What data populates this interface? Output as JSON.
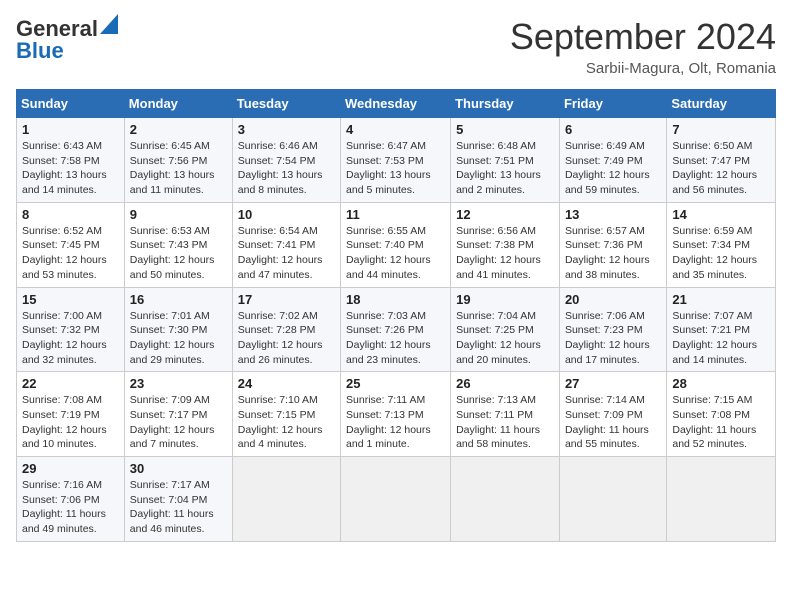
{
  "header": {
    "logo_line1": "General",
    "logo_line2": "Blue",
    "month_title": "September 2024",
    "location": "Sarbii-Magura, Olt, Romania"
  },
  "columns": [
    "Sunday",
    "Monday",
    "Tuesday",
    "Wednesday",
    "Thursday",
    "Friday",
    "Saturday"
  ],
  "weeks": [
    [
      {
        "day": "1",
        "info": "Sunrise: 6:43 AM\nSunset: 7:58 PM\nDaylight: 13 hours\nand 14 minutes."
      },
      {
        "day": "2",
        "info": "Sunrise: 6:45 AM\nSunset: 7:56 PM\nDaylight: 13 hours\nand 11 minutes."
      },
      {
        "day": "3",
        "info": "Sunrise: 6:46 AM\nSunset: 7:54 PM\nDaylight: 13 hours\nand 8 minutes."
      },
      {
        "day": "4",
        "info": "Sunrise: 6:47 AM\nSunset: 7:53 PM\nDaylight: 13 hours\nand 5 minutes."
      },
      {
        "day": "5",
        "info": "Sunrise: 6:48 AM\nSunset: 7:51 PM\nDaylight: 13 hours\nand 2 minutes."
      },
      {
        "day": "6",
        "info": "Sunrise: 6:49 AM\nSunset: 7:49 PM\nDaylight: 12 hours\nand 59 minutes."
      },
      {
        "day": "7",
        "info": "Sunrise: 6:50 AM\nSunset: 7:47 PM\nDaylight: 12 hours\nand 56 minutes."
      }
    ],
    [
      {
        "day": "8",
        "info": "Sunrise: 6:52 AM\nSunset: 7:45 PM\nDaylight: 12 hours\nand 53 minutes."
      },
      {
        "day": "9",
        "info": "Sunrise: 6:53 AM\nSunset: 7:43 PM\nDaylight: 12 hours\nand 50 minutes."
      },
      {
        "day": "10",
        "info": "Sunrise: 6:54 AM\nSunset: 7:41 PM\nDaylight: 12 hours\nand 47 minutes."
      },
      {
        "day": "11",
        "info": "Sunrise: 6:55 AM\nSunset: 7:40 PM\nDaylight: 12 hours\nand 44 minutes."
      },
      {
        "day": "12",
        "info": "Sunrise: 6:56 AM\nSunset: 7:38 PM\nDaylight: 12 hours\nand 41 minutes."
      },
      {
        "day": "13",
        "info": "Sunrise: 6:57 AM\nSunset: 7:36 PM\nDaylight: 12 hours\nand 38 minutes."
      },
      {
        "day": "14",
        "info": "Sunrise: 6:59 AM\nSunset: 7:34 PM\nDaylight: 12 hours\nand 35 minutes."
      }
    ],
    [
      {
        "day": "15",
        "info": "Sunrise: 7:00 AM\nSunset: 7:32 PM\nDaylight: 12 hours\nand 32 minutes."
      },
      {
        "day": "16",
        "info": "Sunrise: 7:01 AM\nSunset: 7:30 PM\nDaylight: 12 hours\nand 29 minutes."
      },
      {
        "day": "17",
        "info": "Sunrise: 7:02 AM\nSunset: 7:28 PM\nDaylight: 12 hours\nand 26 minutes."
      },
      {
        "day": "18",
        "info": "Sunrise: 7:03 AM\nSunset: 7:26 PM\nDaylight: 12 hours\nand 23 minutes."
      },
      {
        "day": "19",
        "info": "Sunrise: 7:04 AM\nSunset: 7:25 PM\nDaylight: 12 hours\nand 20 minutes."
      },
      {
        "day": "20",
        "info": "Sunrise: 7:06 AM\nSunset: 7:23 PM\nDaylight: 12 hours\nand 17 minutes."
      },
      {
        "day": "21",
        "info": "Sunrise: 7:07 AM\nSunset: 7:21 PM\nDaylight: 12 hours\nand 14 minutes."
      }
    ],
    [
      {
        "day": "22",
        "info": "Sunrise: 7:08 AM\nSunset: 7:19 PM\nDaylight: 12 hours\nand 10 minutes."
      },
      {
        "day": "23",
        "info": "Sunrise: 7:09 AM\nSunset: 7:17 PM\nDaylight: 12 hours\nand 7 minutes."
      },
      {
        "day": "24",
        "info": "Sunrise: 7:10 AM\nSunset: 7:15 PM\nDaylight: 12 hours\nand 4 minutes."
      },
      {
        "day": "25",
        "info": "Sunrise: 7:11 AM\nSunset: 7:13 PM\nDaylight: 12 hours\nand 1 minute."
      },
      {
        "day": "26",
        "info": "Sunrise: 7:13 AM\nSunset: 7:11 PM\nDaylight: 11 hours\nand 58 minutes."
      },
      {
        "day": "27",
        "info": "Sunrise: 7:14 AM\nSunset: 7:09 PM\nDaylight: 11 hours\nand 55 minutes."
      },
      {
        "day": "28",
        "info": "Sunrise: 7:15 AM\nSunset: 7:08 PM\nDaylight: 11 hours\nand 52 minutes."
      }
    ],
    [
      {
        "day": "29",
        "info": "Sunrise: 7:16 AM\nSunset: 7:06 PM\nDaylight: 11 hours\nand 49 minutes."
      },
      {
        "day": "30",
        "info": "Sunrise: 7:17 AM\nSunset: 7:04 PM\nDaylight: 11 hours\nand 46 minutes."
      },
      {
        "day": "",
        "info": ""
      },
      {
        "day": "",
        "info": ""
      },
      {
        "day": "",
        "info": ""
      },
      {
        "day": "",
        "info": ""
      },
      {
        "day": "",
        "info": ""
      }
    ]
  ]
}
